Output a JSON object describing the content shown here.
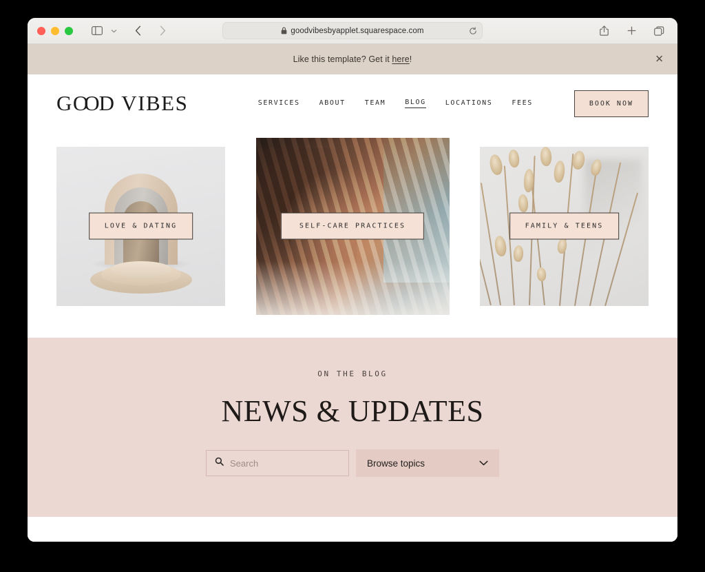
{
  "browser": {
    "traffic_lights": [
      "close",
      "minimize",
      "maximize"
    ],
    "sidebar_icon": "sidebar-icon",
    "sidebar_chevron_icon": "chevron-down-icon",
    "back_icon": "chevron-left-icon",
    "forward_icon": "chevron-right-icon",
    "lock_icon": "lock-icon",
    "url": "goodvibesbyapplet.squarespace.com",
    "reload_icon": "reload-icon",
    "share_icon": "share-icon",
    "new_tab_icon": "plus-icon",
    "tabs_icon": "tabs-overview-icon"
  },
  "promo": {
    "text_before": "Like this template? Get it ",
    "link": "here",
    "text_after": "!",
    "close_icon": "close-icon"
  },
  "header": {
    "logo_part1": "G",
    "logo_oo": "OO",
    "logo_part2": "D VIBES",
    "logo_full": "GOOD VIBES",
    "nav": [
      {
        "label": "SERVICES",
        "active": false
      },
      {
        "label": "ABOUT",
        "active": false
      },
      {
        "label": "TEAM",
        "active": false
      },
      {
        "label": "BLOG",
        "active": true
      },
      {
        "label": "LOCATIONS",
        "active": false
      },
      {
        "label": "FEES",
        "active": false
      }
    ],
    "cta_label": "BOOK NOW"
  },
  "categories": [
    {
      "label": "LOVE & DATING",
      "image": "arch-podium-3d-render"
    },
    {
      "label": "SELF-CARE PRACTICES",
      "image": "hands-dappled-light-photo"
    },
    {
      "label": "FAMILY & TEENS",
      "image": "dried-grasses-photo"
    }
  ],
  "blog": {
    "eyebrow": "ON THE BLOG",
    "title": "NEWS & UPDATES",
    "search_placeholder": "Search",
    "search_value": "",
    "search_icon": "search-icon",
    "topics_label": "Browse topics",
    "topics_chevron_icon": "chevron-down-icon"
  },
  "colors": {
    "promo_banner": "#dcd2c8",
    "blog_section": "#ecd8d2",
    "accent_pink": "#f4dfd4",
    "label_pink": "#f6e1d6",
    "topics_pink": "#e4cbc4",
    "ink": "#2b2b2b"
  }
}
